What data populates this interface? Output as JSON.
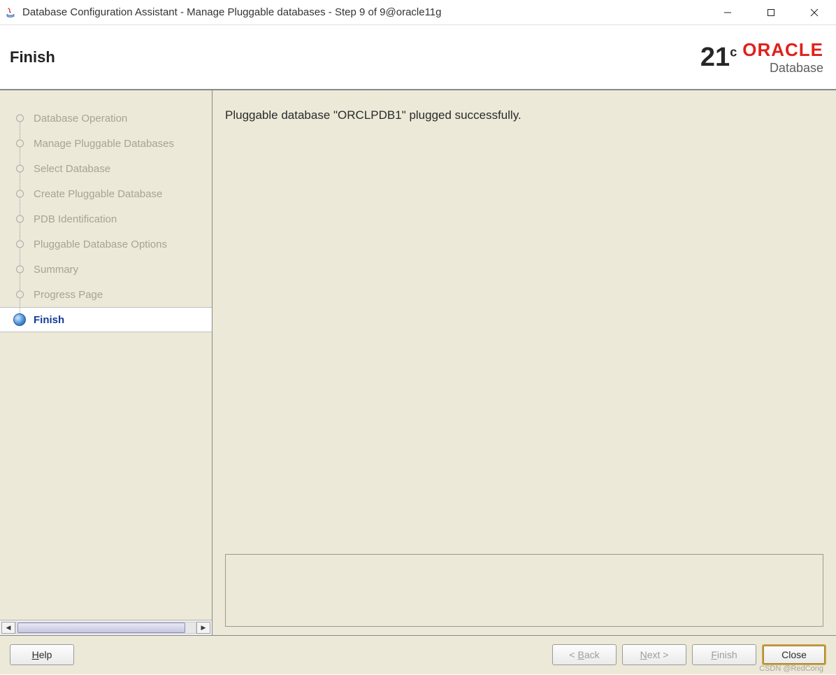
{
  "window": {
    "title": "Database Configuration Assistant - Manage Pluggable databases - Step 9 of 9@oracle11g"
  },
  "header": {
    "page_title": "Finish",
    "brand_version": "21",
    "brand_suffix": "c",
    "brand_name": "ORACLE",
    "brand_sub": "Database"
  },
  "sidebar": {
    "steps": [
      {
        "label": "Database Operation",
        "state": "dim"
      },
      {
        "label": "Manage Pluggable Databases",
        "state": "dim"
      },
      {
        "label": "Select Database",
        "state": "dim"
      },
      {
        "label": "Create Pluggable Database",
        "state": "dim"
      },
      {
        "label": "PDB Identification",
        "state": "dim"
      },
      {
        "label": "Pluggable Database Options",
        "state": "dim"
      },
      {
        "label": "Summary",
        "state": "dim"
      },
      {
        "label": "Progress Page",
        "state": "dim"
      },
      {
        "label": "Finish",
        "state": "active"
      }
    ]
  },
  "content": {
    "message": "Pluggable database \"ORCLPDB1\" plugged successfully."
  },
  "footer": {
    "help": "Help",
    "back": "< Back",
    "next": "Next >",
    "finish": "Finish",
    "close": "Close"
  },
  "watermark": "CSDN @RedCong"
}
